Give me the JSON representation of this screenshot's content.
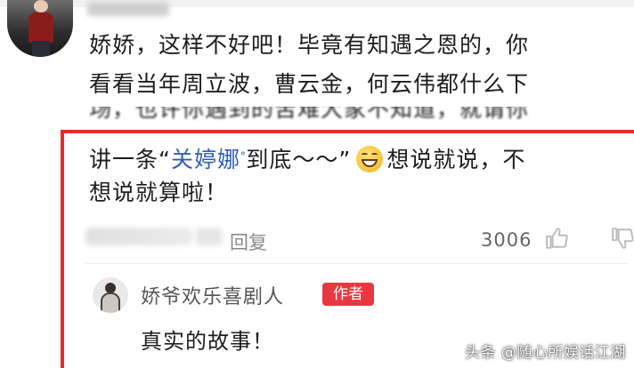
{
  "comment": {
    "lines": [
      "娇娇，这样不好吧！毕竟有知遇之恩的，你",
      "看看当年周立波，曹云金，何云伟都什么下",
      "场，也许你遇到的苦难大家不知道，就请你",
      "想说就说，不",
      "想说就算啦！"
    ],
    "line4_prefix": "讲一条“",
    "highlighted_name": "关婷娜",
    "search_glyph": "ᐤ",
    "line4_quote_tail": "到底～～”",
    "reply_label": "回复",
    "like_count": "3006"
  },
  "reply": {
    "author": "娇爷欢乐喜剧人",
    "badge": "作者",
    "text": "真实的故事！"
  },
  "watermark": "头条 @随心所娱话江湖",
  "colors": {
    "highlight_frame": "#e52a2a",
    "name_link": "#2f5fb8",
    "author_badge": "#e6393f"
  },
  "icons": {
    "emoji": "grinning-face-icon",
    "like": "thumb-up-icon",
    "dislike": "thumb-down-icon"
  }
}
